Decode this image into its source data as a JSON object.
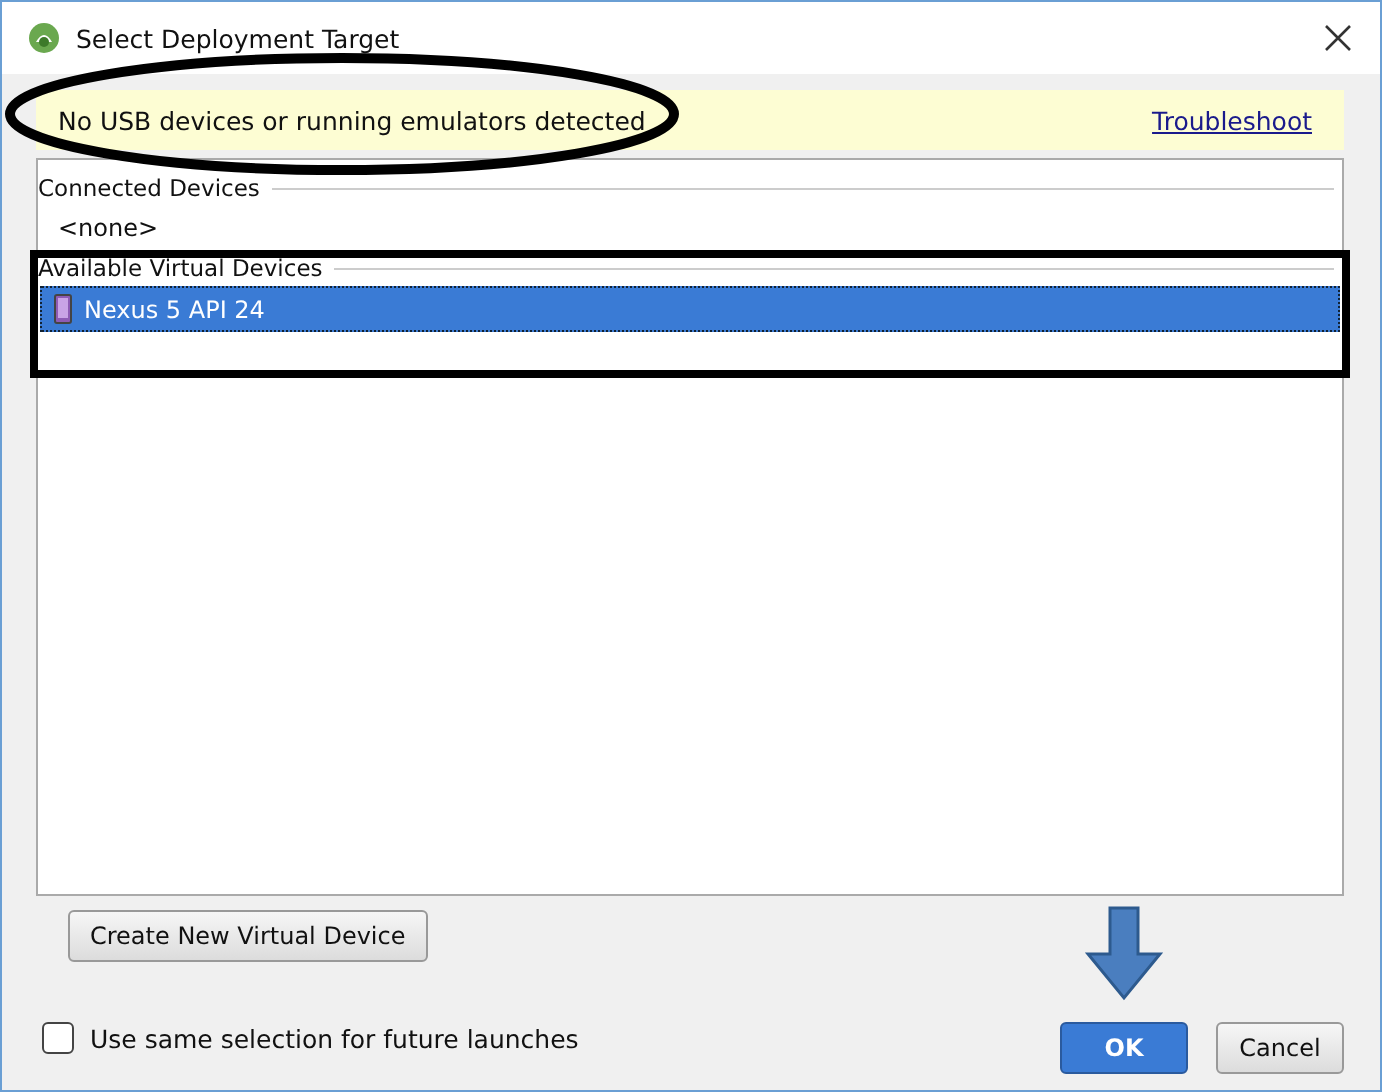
{
  "window": {
    "title": "Select Deployment Target"
  },
  "banner": {
    "message": "No USB devices or running emulators detected",
    "link": "Troubleshoot"
  },
  "sections": [
    {
      "title": "Connected Devices",
      "items": [
        {
          "kind": "placeholder",
          "label": "<none>",
          "selected": false
        }
      ]
    },
    {
      "title": "Available Virtual Devices",
      "items": [
        {
          "kind": "device",
          "label": "Nexus 5 API 24",
          "selected": true
        }
      ]
    }
  ],
  "create_button": "Create New Virtual Device",
  "remember": {
    "label": "Use same selection for future launches",
    "checked": false
  },
  "buttons": [
    {
      "label": "OK",
      "kind": "primary"
    },
    {
      "label": "Cancel",
      "kind": "secondary"
    }
  ]
}
